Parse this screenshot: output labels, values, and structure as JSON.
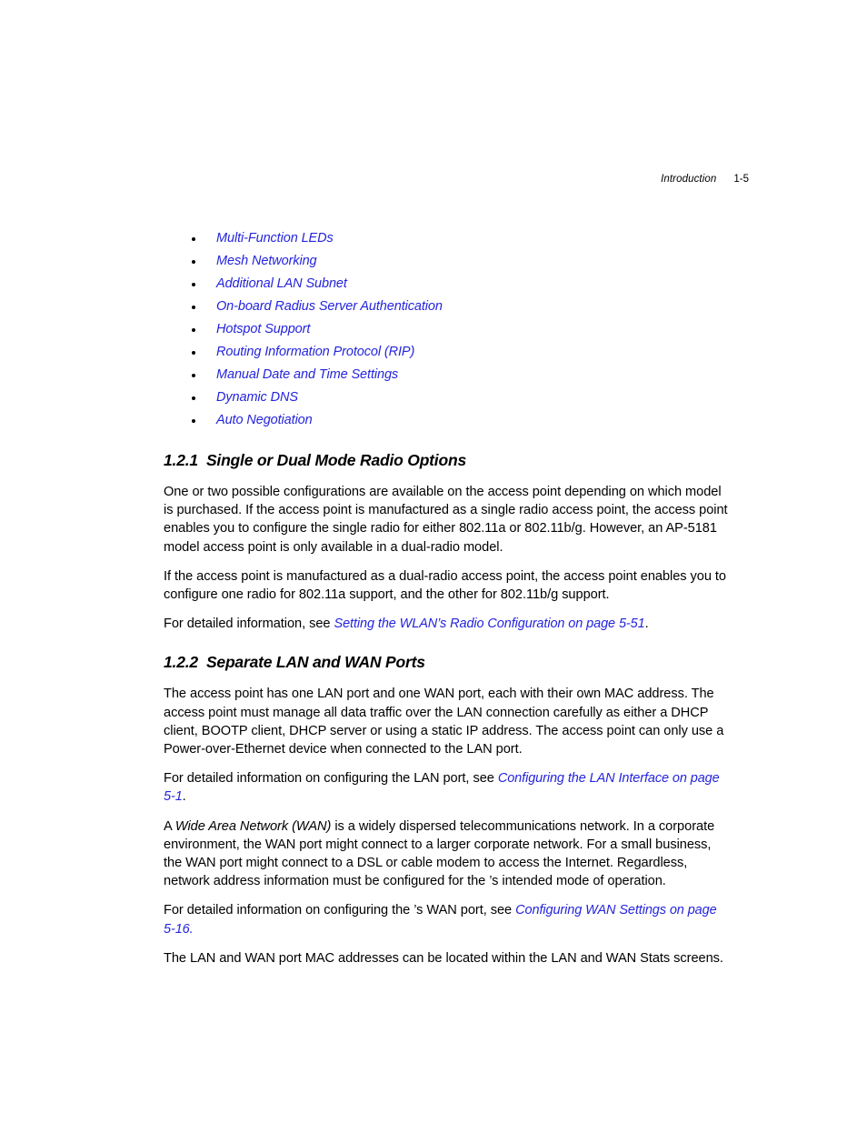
{
  "header": {
    "title": "Introduction",
    "folio": "1-5"
  },
  "feature_list": {
    "items": [
      "Multi-Function LEDs",
      "Mesh Networking",
      "Additional LAN Subnet",
      "On-board Radius Server Authentication",
      "Hotspot Support",
      "Routing Information Protocol (RIP)",
      "Manual Date and Time Settings",
      "Dynamic DNS",
      "Auto Negotiation"
    ]
  },
  "sections": [
    {
      "number": "1.2.1",
      "title": "Single or Dual Mode Radio Options",
      "paragraph_1": "One or two possible configurations are available on the access point depending on which model is purchased. If the access point is manufactured as a single radio access point, the access point enables you to configure the single radio for either 802.11a or 802.11b/g. However, an AP-5181 model access point is only available in a dual-radio model.",
      "paragraph_2": "If the access point is manufactured as a dual-radio access point, the access point enables you to configure one radio for 802.11a support, and the other for 802.11b/g support.",
      "xref_lead": "For detailed information, see ",
      "xref_link": "Setting the WLAN’s Radio Configuration on page 5-51",
      "xref_tail": "."
    },
    {
      "number": "1.2.2",
      "title": "Separate LAN and WAN Ports",
      "paragraph_1": "The access point has one LAN port and one WAN port, each with their own MAC address. The access point must manage all data traffic over the LAN connection carefully as either a DHCP client, BOOTP client, DHCP server or using a static IP address. The access point can only use a Power-over-Ethernet device when connected to the LAN port.",
      "xref_lan_lead": "For detailed information on configuring the  LAN port, see ",
      "xref_lan_link": "Configuring the LAN Interface on page 5-1",
      "xref_lan_tail": ".",
      "paragraph_wan_a": "A ",
      "paragraph_wan_italic": "Wide Area Network (WAN)",
      "paragraph_wan_b": " is a widely dispersed telecommunications network. In a corporate environment, the WAN port might connect to a larger corporate network. For a small business, the WAN port might connect to a DSL or cable modem to access the Internet. Regardless, network address information must be configured for the ’s intended mode of operation.",
      "xref_wan_lead": "For detailed information on configuring the ’s WAN port, see ",
      "xref_wan_link": "Configuring WAN Settings on page 5-16.",
      "paragraph_last": "The LAN and WAN port MAC addresses can be located within the LAN and WAN Stats screens."
    }
  ]
}
